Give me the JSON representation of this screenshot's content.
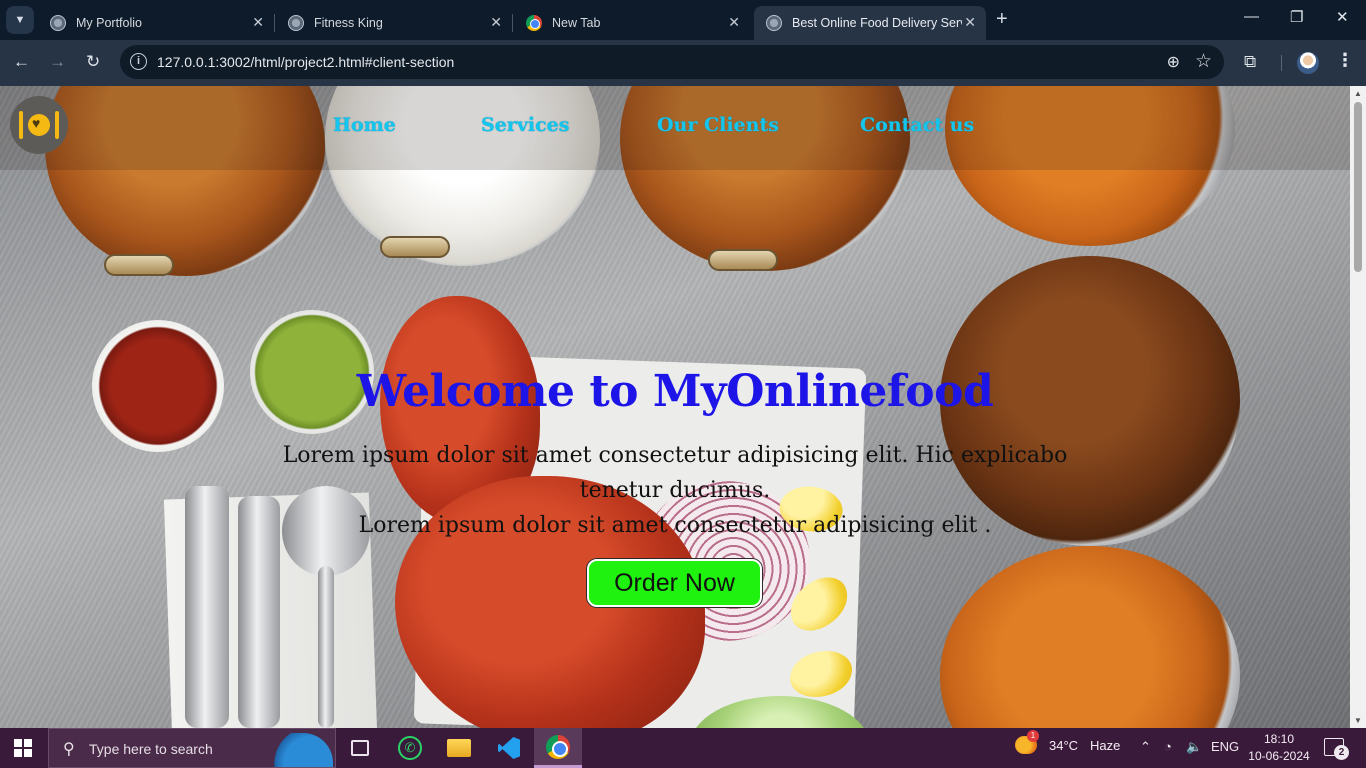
{
  "browser": {
    "tabs": [
      {
        "title": "My Portfolio",
        "icon": "globe-icon",
        "active": false
      },
      {
        "title": "Fitness King",
        "icon": "globe-icon",
        "active": false
      },
      {
        "title": "New Tab",
        "icon": "chrome-icon",
        "active": false
      },
      {
        "title": "Best Online Food Delivery Service",
        "icon": "globe-icon",
        "active": true
      }
    ],
    "new_tab_symbol": "+",
    "close_symbol": "✕",
    "url": "127.0.0.1:3002/html/project2.html#client-section"
  },
  "page": {
    "nav": {
      "links": [
        "Home",
        "Services",
        "Our Clients",
        "Contact us"
      ]
    },
    "hero": {
      "title": "Welcome to MyOnlinefood",
      "line1": "Lorem ipsum dolor sit amet consectetur adipisicing elit. Hic explicabo tenetur ducimus.",
      "line2": "Lorem ipsum dolor sit amet consectetur adipisicing elit .",
      "button": "Order Now"
    },
    "colors": {
      "nav_link": "#14c6ee",
      "title": "#1d14e8",
      "button_bg": "#1ef20e"
    }
  },
  "taskbar": {
    "search_placeholder": "Type here to search",
    "weather": {
      "temp": "34°C",
      "condition": "Haze",
      "alert_count": "1"
    },
    "language": "ENG",
    "time": "18:10",
    "date": "10-06-2024",
    "notification_count": "2"
  }
}
